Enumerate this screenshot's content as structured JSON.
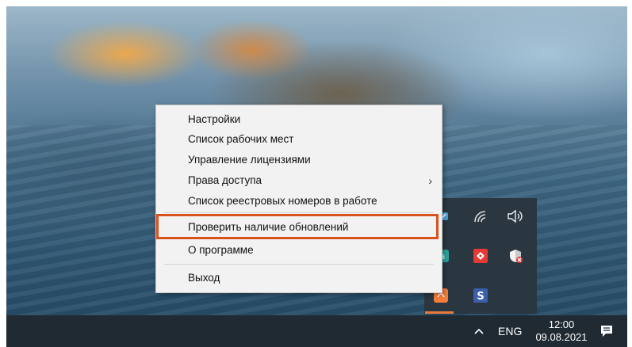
{
  "context_menu": {
    "items": [
      {
        "label": "Настройки"
      },
      {
        "label": "Список рабочих мест"
      },
      {
        "label": "Управление лицензиями"
      },
      {
        "label": "Права доступа",
        "submenu": true
      },
      {
        "label": "Список реестровых номеров в работе"
      },
      {
        "label": "Проверить наличие обновлений",
        "highlighted": true
      },
      {
        "label": "О программе"
      },
      {
        "label": "Выход"
      }
    ],
    "submenu_arrow": "›",
    "highlight_color": "#d9521e"
  },
  "tray": {
    "icons": [
      "onedrive-check-icon",
      "wifi-icon",
      "volume-icon",
      "app-a-icon",
      "anydesk-icon",
      "security-warning-icon",
      "app-orange-icon",
      "s-app-icon"
    ]
  },
  "taskbar": {
    "language": "ENG",
    "time": "12:00",
    "date": "09.08.2021"
  }
}
